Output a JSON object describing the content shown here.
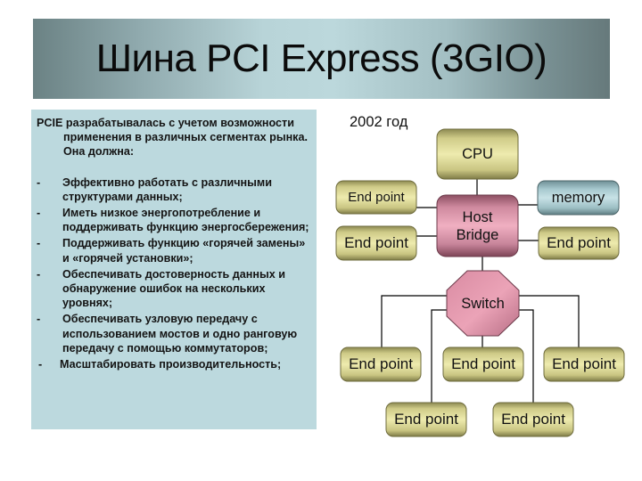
{
  "title": "Шина PCI Express (3GIO)",
  "left_panel": {
    "intro": "PCIE разрабатывалась с учетом возможности применения в различных сегментах рынка. Она должна:",
    "bullet_marker": "-",
    "requirements": [
      "Эффективно работать с различными структурами данных;",
      "Иметь низкое энергопотребление и поддерживать функцию энергосбережения;",
      "Поддерживать функцию «горячей замены» и «горячей установки»;",
      "Обеспечивать достоверность данных и обнаружение ошибок на нескольких уровнях;",
      "Обеспечивать узловую передачу с использованием мостов и одно ранговую передачу с помощью коммутаторов;",
      "Масштабировать производительность;"
    ]
  },
  "diagram": {
    "year_label": "2002 год",
    "colors": {
      "endpoint": "#d8d48e",
      "memory": "#a8cdd3",
      "bridge": "#d98ea4",
      "switch": "#e195ab",
      "line": "#000000"
    },
    "nodes": {
      "cpu": "CPU",
      "host_bridge": "Host Bridge",
      "memory": "memory",
      "switch": "Switch",
      "endpoint_bridge_left_top": "End point",
      "endpoint_bridge_left_bottom": "End point",
      "endpoint_bridge_right": "End point",
      "endpoint_switch_1": "End point",
      "endpoint_switch_2": "End point",
      "endpoint_switch_3": "End point",
      "endpoint_switch_4": "End point",
      "endpoint_switch_5": "End point"
    },
    "connections": [
      [
        "cpu",
        "host_bridge"
      ],
      [
        "endpoint_bridge_left_top",
        "host_bridge"
      ],
      [
        "endpoint_bridge_left_bottom",
        "host_bridge"
      ],
      [
        "host_bridge",
        "memory"
      ],
      [
        "host_bridge",
        "endpoint_bridge_right"
      ],
      [
        "host_bridge",
        "switch"
      ],
      [
        "switch",
        "endpoint_switch_1"
      ],
      [
        "switch",
        "endpoint_switch_2"
      ],
      [
        "switch",
        "endpoint_switch_3"
      ],
      [
        "switch",
        "endpoint_switch_4"
      ],
      [
        "switch",
        "endpoint_switch_5"
      ]
    ]
  }
}
